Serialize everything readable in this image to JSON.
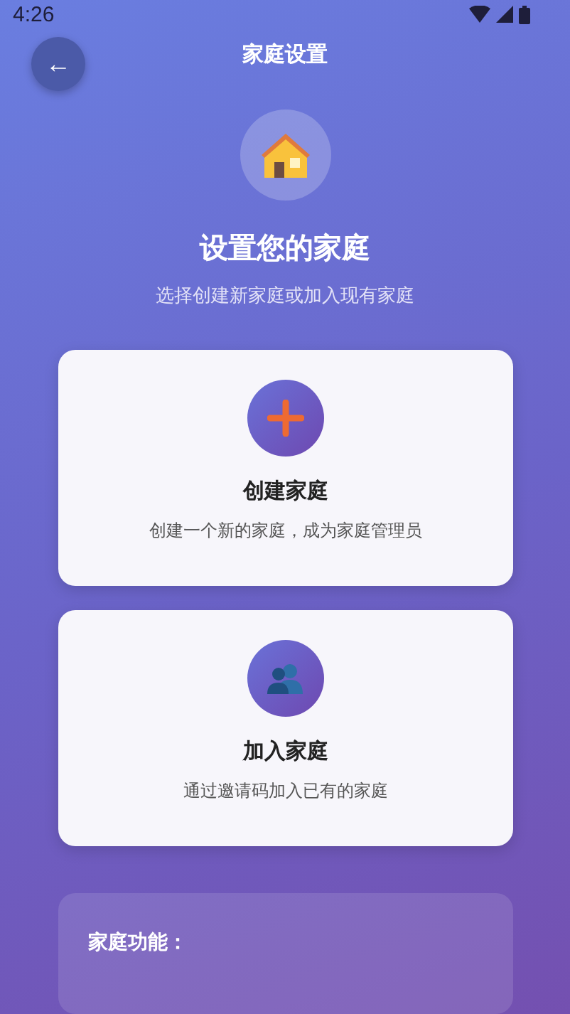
{
  "status_bar": {
    "time": "4:26"
  },
  "header": {
    "back": "←",
    "title": "家庭设置"
  },
  "hero": {
    "title": "设置您的家庭",
    "subtitle": "选择创建新家庭或加入现有家庭"
  },
  "options": [
    {
      "kind": "create",
      "title": "创建家庭",
      "description": "创建一个新的家庭，成为家庭管理员"
    },
    {
      "kind": "join",
      "title": "加入家庭",
      "description": "通过邀请码加入已有的家庭"
    }
  ],
  "features": {
    "title": "家庭功能："
  }
}
